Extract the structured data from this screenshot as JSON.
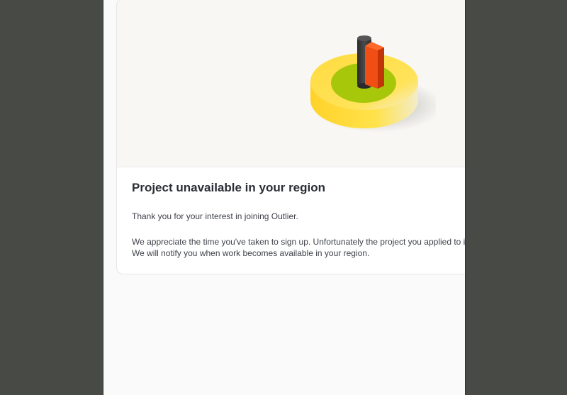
{
  "dialog": {
    "illustration": "flag-on-target-icon",
    "title": "Project unavailable in your region",
    "thanks_text": "Thank you for your interest in joining Outlier.",
    "message_line1": "We appreciate the time you've taken to sign up. Unfortunately the project you applied to is una",
    "message_line2": "We will notify you when work becomes available in your region."
  },
  "colors": {
    "backdrop": "#474a45",
    "panel": "#fafafa",
    "hero_background": "#f8f7f4",
    "target_outer": "#ffd93a",
    "target_inner": "#a7c80a",
    "flag": "#f04e14",
    "pole": "#333333"
  }
}
